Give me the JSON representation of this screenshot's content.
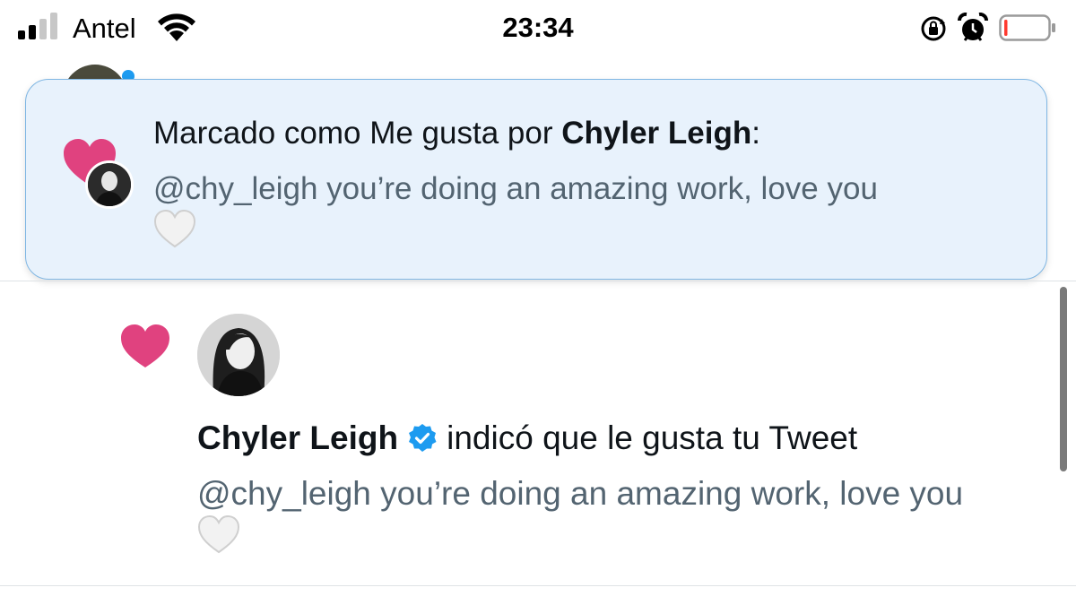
{
  "status_bar": {
    "carrier": "Antel",
    "time": "23:34",
    "signal_icon": "cellular-signal-icon",
    "wifi_icon": "wifi-icon",
    "rotation_lock_icon": "rotation-lock-icon",
    "alarm_icon": "alarm-clock-icon",
    "battery_icon": "battery-icon",
    "battery_level": 0.05
  },
  "banner": {
    "headline_prefix": "Marcado como Me gusta por ",
    "headline_name": "Chyler Leigh",
    "headline_suffix": ":",
    "body": "@chy_leigh you’re doing an amazing work, love you",
    "heart_icon": "pink-heart-icon",
    "emoji": "white-heart-emoji"
  },
  "notification": {
    "name": "Chyler Leigh",
    "action": "indicó que le gusta tu Tweet",
    "body": "@chy_leigh you’re doing an amazing work, love you",
    "heart_icon": "pink-heart-icon",
    "verified_icon": "verified-badge-icon",
    "emoji": "white-heart-emoji"
  },
  "colors": {
    "like_pink": "#e0427f",
    "verified_blue": "#1d9bf0",
    "banner_background": "#e8f2fc",
    "banner_border": "#7fb6e3",
    "secondary_text": "#536471",
    "primary_text": "#0f1419"
  }
}
